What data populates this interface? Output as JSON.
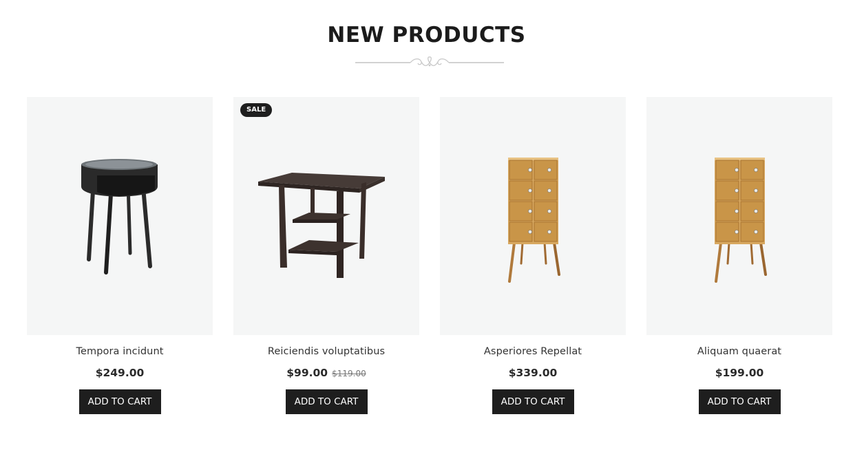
{
  "section": {
    "title": "NEW PRODUCTS"
  },
  "products": [
    {
      "name": "Tempora incidunt",
      "price": "$249.00",
      "old_price": "",
      "badge": "",
      "image": "round-side-table-image",
      "button_label": "ADD TO CART"
    },
    {
      "name": "Reiciendis voluptatibus",
      "price": "$99.00",
      "old_price": "$119.00",
      "badge": "SALE",
      "image": "dark-wood-table-image",
      "button_label": "ADD TO CART"
    },
    {
      "name": "Asperiores Repellat",
      "price": "$339.00",
      "old_price": "",
      "badge": "",
      "image": "drawer-cabinet-image",
      "button_label": "ADD TO CART"
    },
    {
      "name": "Aliquam quaerat",
      "price": "$199.00",
      "old_price": "",
      "badge": "",
      "image": "drawer-cabinet-image",
      "button_label": "ADD TO CART"
    }
  ],
  "colors": {
    "accent": "#1e1e1e",
    "image_bg": "#f5f6f6",
    "text": "#333333"
  }
}
